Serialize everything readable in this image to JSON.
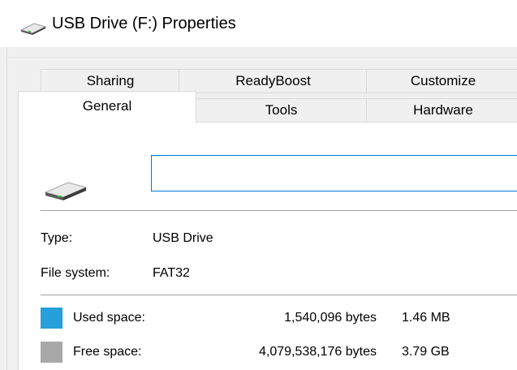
{
  "window": {
    "title": "USB Drive (F:) Properties"
  },
  "tabs": {
    "row_back": [
      "Sharing",
      "ReadyBoost",
      "Customize"
    ],
    "row_front": [
      "General",
      "Tools",
      "Hardware"
    ],
    "active": "General"
  },
  "general": {
    "volume_label": "",
    "type_label": "Type:",
    "type_value": "USB Drive",
    "fs_label": "File system:",
    "fs_value": "FAT32",
    "used": {
      "label": "Used space:",
      "bytes": "1,540,096 bytes",
      "size": "1.46 MB",
      "color": "#26a0da"
    },
    "free": {
      "label": "Free space:",
      "bytes": "4,079,538,176 bytes",
      "size": "3.79 GB",
      "color": "#a8a8a8"
    }
  },
  "icons": {
    "title": "usb-drive-icon",
    "drive": "usb-drive-icon"
  }
}
